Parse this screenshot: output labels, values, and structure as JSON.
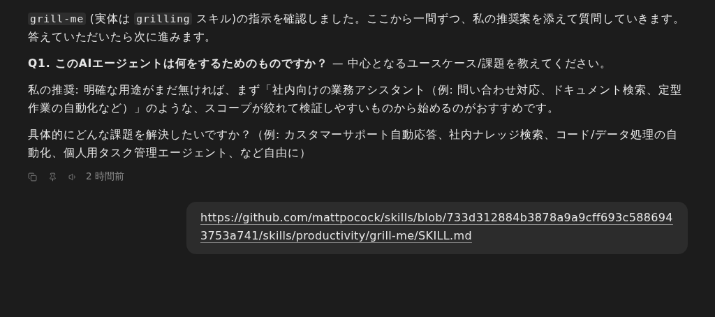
{
  "assistant_message": {
    "paragraphs": [
      {
        "segments": [
          {
            "kind": "code",
            "text": "grill-me"
          },
          {
            "kind": "text",
            "text": " (実体は "
          },
          {
            "kind": "code",
            "text": "grilling"
          },
          {
            "kind": "text",
            "text": " スキル)の指示を確認しました。ここから一問ずつ、私の推奨案を添えて質問していきます。答えていただいたら次に進みます。"
          }
        ]
      },
      {
        "segments": [
          {
            "kind": "text",
            "text": "**Q1. このAIエージェントは何をするためのものですか？** — 中心となるユースケース/課題を教えてください。"
          }
        ]
      },
      {
        "segments": [
          {
            "kind": "text",
            "text": "私の推奨: 明確な用途がまだ無ければ、まず「社内向けの業務アシスタント（例: 問い合わせ対応、ドキュメント検索、定型作業の自動化など）」のような、スコープが絞れて検証しやすいものから始めるのがおすすめです。"
          }
        ]
      },
      {
        "segments": [
          {
            "kind": "text",
            "text": "具体的にどんな課題を解決したいですか？（例: カスタマーサポート自動応答、社内ナレッジ検索、コード/データ処理の自動化、個人用タスク管理エージェント、など自由に）"
          }
        ]
      }
    ],
    "actions": [
      {
        "kind": "copy"
      },
      {
        "kind": "pin"
      },
      {
        "kind": "speak"
      }
    ],
    "timestamp": "2 時間前"
  },
  "user_message": {
    "link": "https://github.com/mattpocock/skills/blob/733d312884b3878a9a9cff693c5886943753a741/skills/productivity/grill-me/SKILL.md"
  }
}
